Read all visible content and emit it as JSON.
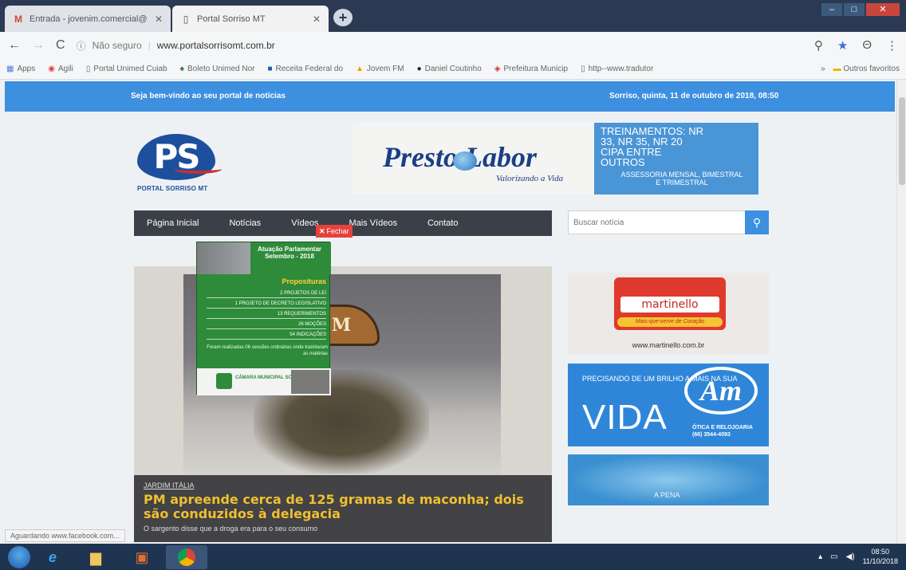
{
  "browser": {
    "tabs": [
      {
        "label": "Entrada - jovenim.comercial@",
        "icon": "gmail-icon"
      },
      {
        "label": "Portal Sorriso MT",
        "icon": "page-icon"
      }
    ],
    "nav": {
      "back": "←",
      "forward": "→",
      "reload": "C"
    },
    "security_label": "Não seguro",
    "url": "www.portalsorrisomt.com.br",
    "bookmarks": [
      "Apps",
      "Agili",
      "Portal Unimed Cuiab",
      "Boleto Unimed Nor",
      "Receita Federal do",
      "Jovem FM",
      "Daniel Coutinho",
      "Prefeitura Municip",
      "http--www.tradutor"
    ],
    "bookmarks_more": "»",
    "other_bookmarks": "Outros favoritos"
  },
  "site": {
    "welcome": "Seja bem-vindo ao seu portal de notícias",
    "date": "Sorriso, quinta, 11 de outubro de 2018, 08:50",
    "logo_text": "PS",
    "logo_name": "PORTAL SORRISO MT",
    "banner": {
      "brand": "Presto Labor",
      "slogan": "Valorizando a Vida",
      "title": "TREINAMENTOS: NR 33, NR 35, NR 20 CIPA ENTRE OUTROS",
      "sub": "ASSESSORIA MENSAL, BIMESTRAL E TRIMESTRAL"
    },
    "menu": [
      "Página Inicial",
      "Notícias",
      "Vídeos",
      "Mais Vídeos",
      "Contato"
    ],
    "close_label": "Fechar",
    "search_placeholder": "Buscar notícia",
    "article": {
      "badge_text": "12ºBPM",
      "category": "JARDIM ITÁLIA",
      "headline": "PM apreende cerca de 125 gramas de maconha; dois são conduzidos à delegacia",
      "lead": "O sargento disse que a droga era para o seu consumo"
    },
    "popup": {
      "title": "Atuação Parlamentar Setembro - 2018",
      "section": "Proposituras",
      "rows": [
        "2 PROJETOS DE LEI",
        "1 PROJETO DE DECRETO LEGISLATIVO",
        "13 REQUERIMENTOS",
        "26 MOÇÕES",
        "54 INDICAÇÕES"
      ],
      "footer": "Foram realizadas 06 sessões ordinárias onde tramitaram as matérias",
      "gov": "CÂMARA MUNICIPAL SORRISO"
    },
    "ads": {
      "martinello_name": "martinello",
      "martinello_tag": "Mais-que-serve de Coração",
      "martinello_url": "www.martinello.com.br",
      "am_question": "PRECISANDO DE UM BRILHO A MAIS NA SUA",
      "am_big": "VIDA",
      "am_logo": "Am",
      "am_desc": "ÓTICA E RELOJOARIA",
      "am_phone": "(66) 3544-4093",
      "ad3_text": "A PENA"
    }
  },
  "status_text": "Aguardando www.facebook.com...",
  "taskbar": {
    "time": "08:50",
    "date": "11/10/2018"
  }
}
